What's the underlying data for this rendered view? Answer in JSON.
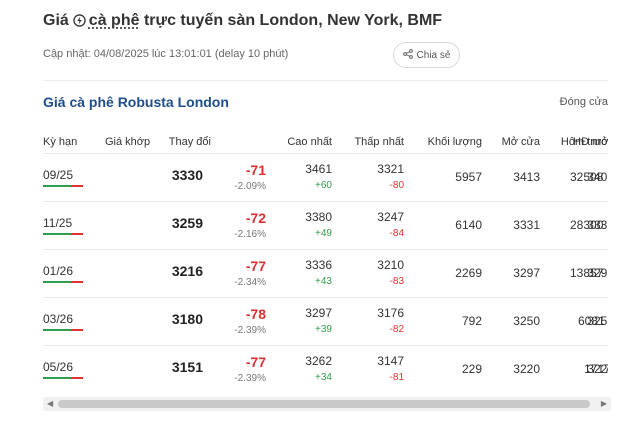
{
  "header": {
    "title_prefix": "Giá",
    "title_keyword": "cà phê",
    "title_suffix": "trực tuyến sàn London, New York, BMF",
    "updated": "Cập nhật: 04/08/2025 lúc 13:01:01 (delay 10 phút)",
    "share_label": "Chia sẻ"
  },
  "section": {
    "title": "Giá cà phê Robusta London",
    "close_label": "Đóng cửa"
  },
  "table": {
    "columns": [
      "Kỳ hạn",
      "Giá khớp",
      "Thay đổi",
      "Cao nhất",
      "Thấp nhất",
      "Khối lượng",
      "Mở cửa",
      "Hôm trước",
      "HĐ mở"
    ],
    "rows": [
      {
        "term": "09/25",
        "price": "3330",
        "change": "-71",
        "change_pct": "-2.09%",
        "high": "3461",
        "high_diff": "+60",
        "low": "3321",
        "low_diff": "-80",
        "volume": "5957",
        "open": "3413",
        "prev": "3401",
        "oi": "32508"
      },
      {
        "term": "11/25",
        "price": "3259",
        "change": "-72",
        "change_pct": "-2.16%",
        "high": "3380",
        "high_diff": "+49",
        "low": "3247",
        "low_diff": "-84",
        "volume": "6140",
        "open": "3331",
        "prev": "3331",
        "oi": "28300"
      },
      {
        "term": "01/26",
        "price": "3216",
        "change": "-77",
        "change_pct": "-2.34%",
        "high": "3336",
        "high_diff": "+43",
        "low": "3210",
        "low_diff": "-83",
        "volume": "2269",
        "open": "3297",
        "prev": "3293",
        "oi": "13857"
      },
      {
        "term": "03/26",
        "price": "3180",
        "change": "-78",
        "change_pct": "-2.39%",
        "high": "3297",
        "high_diff": "+39",
        "low": "3176",
        "low_diff": "-82",
        "volume": "792",
        "open": "3250",
        "prev": "3258",
        "oi": "6081"
      },
      {
        "term": "05/26",
        "price": "3151",
        "change": "-77",
        "change_pct": "-2.39%",
        "high": "3262",
        "high_diff": "+34",
        "low": "3147",
        "low_diff": "-81",
        "volume": "229",
        "open": "3220",
        "prev": "3228",
        "oi": "1717"
      }
    ]
  },
  "colors": {
    "accent_blue": "#1f4e8c",
    "down_red": "#e03030",
    "up_green": "#2e9e4c"
  },
  "icons": {
    "title": "bolt-circle-icon",
    "share": "share-icon",
    "scroll_left": "arrow-left-icon",
    "scroll_right": "arrow-right-icon"
  }
}
